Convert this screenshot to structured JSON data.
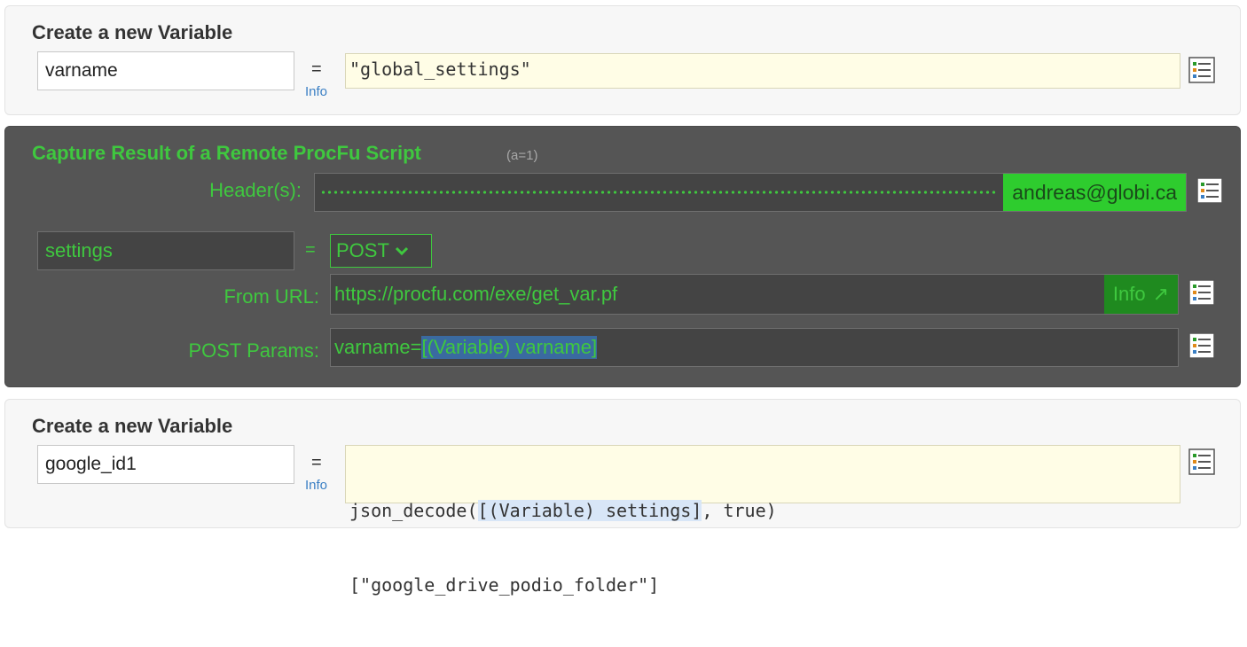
{
  "block1": {
    "title": "Create a new Variable",
    "varname": "varname",
    "equals": "=",
    "info": "Info",
    "expression": "\"global_settings\""
  },
  "block2": {
    "title": "Capture Result of a Remote ProcFu Script",
    "subtitle": "(a=1)",
    "header_label": "Header(s):",
    "header_email": "andreas@globi.ca",
    "varname": "settings",
    "equals": "=",
    "method": "POST",
    "url_label": "From URL:",
    "url": "https://procfu.com/exe/get_var.pf",
    "info_button": "Info",
    "info_arrow": "↗",
    "params_label": "POST Params:",
    "params_prefix": "varname=",
    "params_token": "[(Variable) varname]"
  },
  "block3": {
    "title": "Create a new Variable",
    "varname": "google_id1",
    "equals": "=",
    "info": "Info",
    "expr_line1_prefix": "json_decode(",
    "expr_line1_token": "[(Variable) settings]",
    "expr_line1_suffix": ", true)",
    "expr_line2": "[\"google_drive_podio_folder\"]"
  },
  "icons": {
    "list": "list-menu-icon",
    "chevron": "chevron-down-icon",
    "external": "external-link-icon"
  }
}
